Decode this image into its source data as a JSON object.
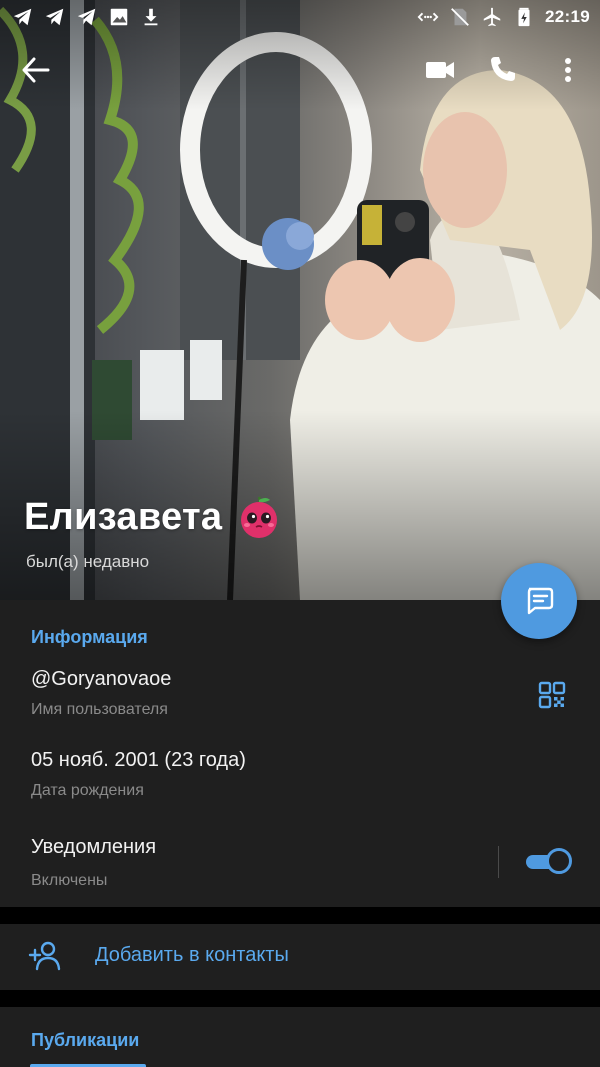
{
  "status_bar": {
    "time": "22:19",
    "left_icons": [
      "telegram-icon",
      "telegram-icon",
      "telegram-icon",
      "image-icon",
      "download-icon"
    ],
    "right_icons": [
      "data-saver-icon",
      "no-sim-icon",
      "airplane-icon",
      "battery-charging-icon"
    ]
  },
  "app_bar": {
    "back_icon": "arrow-back-icon",
    "actions": [
      "video-call-icon",
      "phone-icon",
      "more-vert-icon"
    ]
  },
  "profile": {
    "name": "Елизавета",
    "last_seen": "был(а) недавно",
    "emoji_icon": "cherry-sticker-icon"
  },
  "info": {
    "title": "Информация",
    "username": "@Goryanovaoe",
    "username_label": "Имя пользователя",
    "birthday": "05 нояб. 2001 (23 года)",
    "birthday_label": "Дата рождения",
    "notifications": "Уведомления",
    "notifications_state": "Включены",
    "notifications_on": true
  },
  "actions": {
    "add_contact": "Добавить в контакты"
  },
  "publications": {
    "title": "Публикации"
  },
  "colors": {
    "accent": "#4f9ae0",
    "link": "#5aa9ee",
    "card_bg": "#1f1f1f",
    "page_bg": "#000000"
  }
}
